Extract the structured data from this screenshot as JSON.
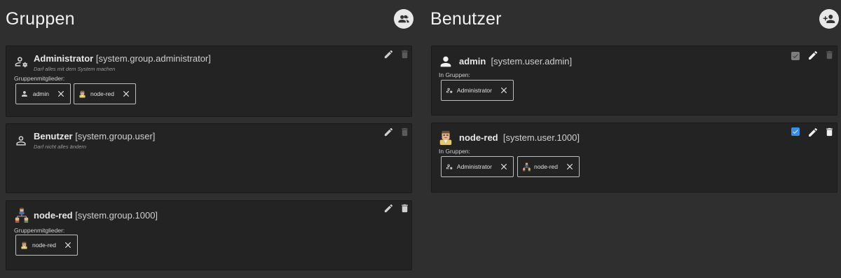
{
  "groups": {
    "title": "Gruppen",
    "add_icon": "add-group-icon",
    "cards": [
      {
        "name": "Administrator",
        "id": "[system.group.administrator]",
        "description": "Darf alles mit dem System machen",
        "members_label": "Gruppenmitglieder:",
        "members": [
          "admin",
          "node-red"
        ]
      },
      {
        "name": "Benutzer",
        "id": "[system.group.user]",
        "description": "Darf nicht alles ändern"
      },
      {
        "name": "node-red",
        "id": "[system.group.1000]",
        "members_label": "Gruppenmitglieder:",
        "members": [
          "node-red"
        ]
      }
    ]
  },
  "users": {
    "title": "Benutzer",
    "add_icon": "add-user-icon",
    "cards": [
      {
        "name": "admin",
        "id": "[system.user.admin]",
        "groups_label": "In Gruppen:",
        "groups": [
          "Administrator"
        ],
        "enabled": true,
        "editable": false
      },
      {
        "name": "node-red",
        "id": "[system.user.1000]",
        "groups_label": "In Gruppen:",
        "groups": [
          "Administrator",
          "node-red"
        ],
        "enabled": true,
        "editable": true
      }
    ]
  },
  "colors": {
    "checkbox_active": "#3b8fe0",
    "checkbox_disabled": "#7d7d7d"
  }
}
